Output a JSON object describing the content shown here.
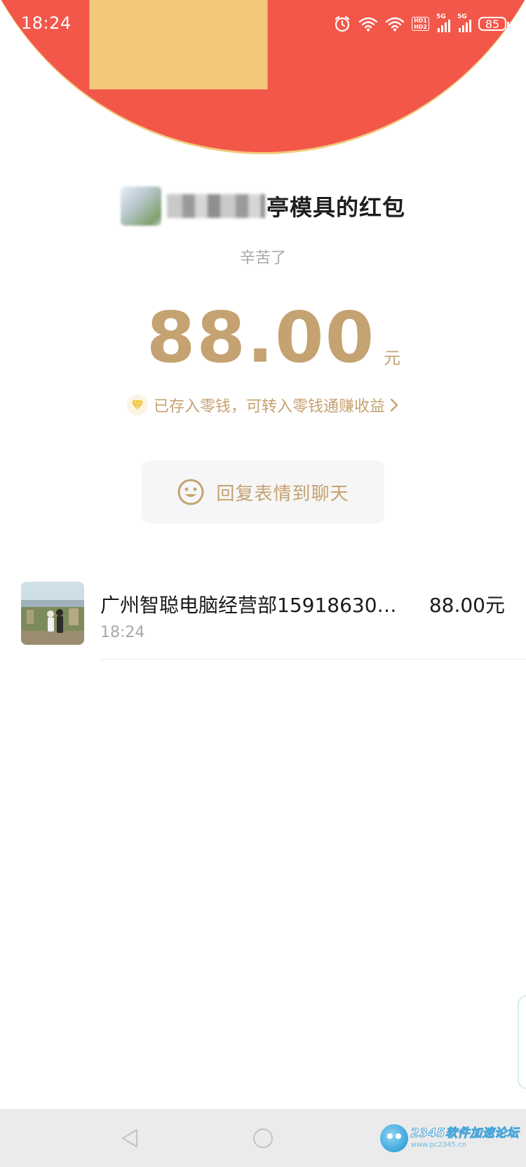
{
  "status_bar": {
    "time": "18:24",
    "hd_top": "HD1",
    "hd_bottom": "HD2",
    "signal1_tag": "5G",
    "signal2_tag": "5G",
    "battery": "85"
  },
  "colors": {
    "header_red": "#f2574a",
    "gold": "#c5a271",
    "header_rim": "#f2c87a",
    "nav_bg": "#ebebeb"
  },
  "header": {
    "back_icon": "chevron-left-icon",
    "more_icon": "more-dots-icon"
  },
  "envelope": {
    "sender_name_visible": "亭模具的红包",
    "blessing": "辛苦了",
    "amount": "88.00",
    "unit": "元",
    "change_note": "已存入零钱，可转入零钱通赚收益",
    "reply_label": "回复表情到聊天"
  },
  "receivers": [
    {
      "name": "广州智聪电脑经营部15918630…",
      "amount": "88.00元",
      "time": "18:24"
    }
  ],
  "nav": {
    "back_icon": "triangle-back-icon",
    "home_icon": "circle-home-icon",
    "recent_icon": "square-recent-icon"
  },
  "watermark": {
    "title": "2345软件加速论坛",
    "url": "www.pc2345.cn"
  }
}
